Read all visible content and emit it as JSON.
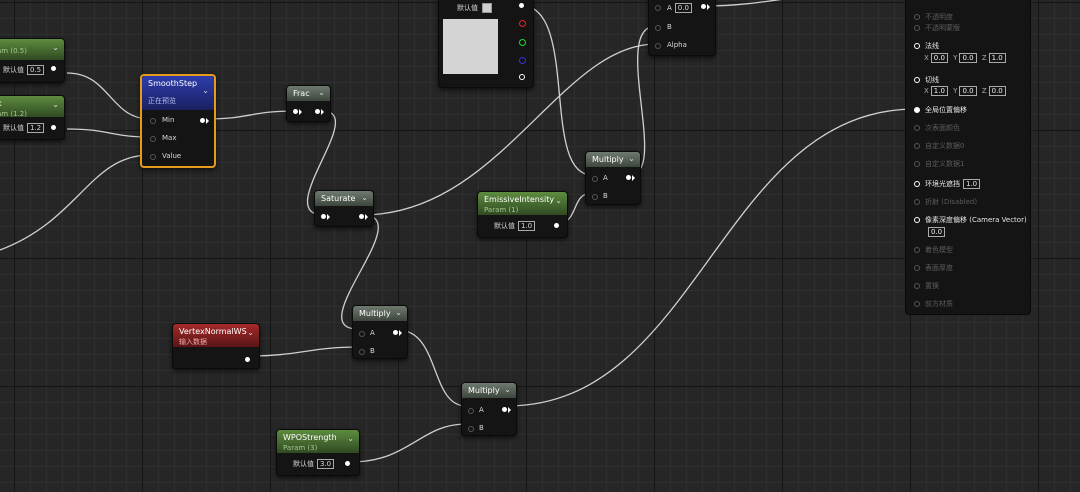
{
  "nodes": {
    "param_a": {
      "subtitle": "am (0.5)",
      "default_label": "默认值",
      "value": "0.5"
    },
    "param_b": {
      "title": "k",
      "subtitle": "am (1.2)",
      "default_label": "默认值",
      "value": "1.2"
    },
    "smoothstep": {
      "title": "SmoothStep",
      "status": "正在预览",
      "in_min": "Min",
      "in_max": "Max",
      "in_value": "Value"
    },
    "frac": {
      "title": "Frac"
    },
    "saturate": {
      "title": "Saturate"
    },
    "vector_param": {
      "default_label": "默认值"
    },
    "lerp": {
      "in_a": "A",
      "a_value": "0.0",
      "in_b": "B",
      "in_alpha": "Alpha"
    },
    "multiply_top": {
      "title": "Multiply",
      "in_a": "A",
      "in_b": "B"
    },
    "emissive_intensity": {
      "title": "EmissiveIntensity",
      "subtitle": "Param (1)",
      "default_label": "默认值",
      "value": "1.0"
    },
    "vertex_normal": {
      "title": "VertexNormalWS",
      "subtitle": "输入数据"
    },
    "multiply_mid": {
      "title": "Multiply",
      "in_a": "A",
      "in_b": "B"
    },
    "multiply_bottom": {
      "title": "Multiply",
      "in_a": "A",
      "in_b": "B"
    },
    "wpo_strength": {
      "title": "WPOStrength",
      "subtitle": "Param (3)",
      "default_label": "默认值",
      "value": "3.0"
    }
  },
  "material_panel": {
    "rows": [
      {
        "label": "不透明度",
        "active": false
      },
      {
        "label": "不透明蒙版",
        "active": false
      },
      {
        "label": "法线",
        "active": true,
        "x": "0.0",
        "y": "0.0",
        "z": "1.0"
      },
      {
        "label": "切线",
        "active": true,
        "x": "1.0",
        "y": "0.0",
        "z": "0.0"
      },
      {
        "label": "全局位置偏移",
        "active": true
      },
      {
        "label": "次表面颜色",
        "active": false
      },
      {
        "label": "自定义数据0",
        "active": false
      },
      {
        "label": "自定义数据1",
        "active": false
      },
      {
        "label": "环境光遮挡",
        "active": true,
        "value": "1.0"
      },
      {
        "label": "折射 (Disabled)",
        "active": false
      },
      {
        "label": "像素深度偏移 (Camera Vector)",
        "active": true,
        "value": "0.0"
      },
      {
        "label": "着色模型",
        "active": false
      },
      {
        "label": "表面厚度",
        "active": false
      },
      {
        "label": "置换",
        "active": false
      },
      {
        "label": "前方材质",
        "active": false
      }
    ],
    "coord_labels": {
      "x": "X",
      "y": "Y",
      "z": "Z"
    }
  }
}
